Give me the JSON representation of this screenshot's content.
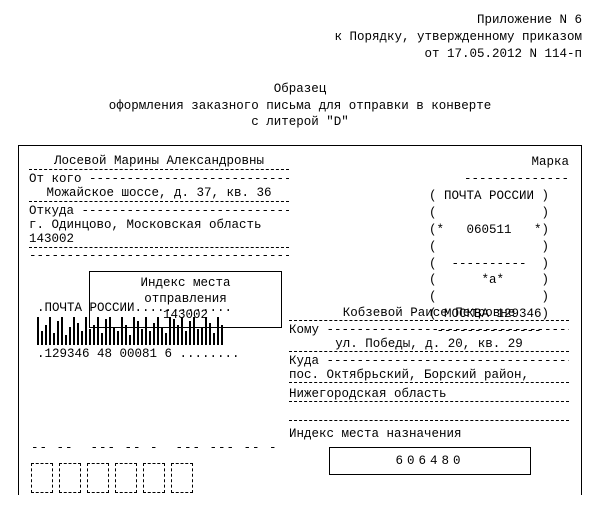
{
  "header": {
    "line1": "Приложение N 6",
    "line2": "к Порядку, утвержденному приказом",
    "line3": "от 17.05.2012 N 114-п"
  },
  "title": {
    "line1": "Образец",
    "line2": "оформления заказного письма для отправки в конверте",
    "line3": "с литерой \"D\""
  },
  "sender": {
    "from_label": "От кого",
    "from_value": "Лосевой Марины Александровны",
    "where_label": "Откуда",
    "addr1": "Можайское шоссе, д. 37, кв. 36",
    "addr2": "г. Одинцово, Московская область 143002",
    "index_label": "Индекс места отправления",
    "index_value": "143002"
  },
  "stamp": {
    "top_label": "Марка",
    "r1": "( ПОЧТА РОССИИ )",
    "r2": "(              )",
    "r3": "(*   060511   *)",
    "r4": "(              )",
    "r5": "(  ----------  )",
    "r6": "(      *a*     )",
    "r7": "(              )",
    "r8": "( МОСКВА 129346)"
  },
  "barcode": {
    "label": ".ПОЧТА РОССИИ.............",
    "digits": ".129346 48 00081 6 ........",
    "heights": [
      28,
      14,
      20,
      28,
      12,
      24,
      28,
      10,
      18,
      28,
      22,
      14,
      28,
      16,
      20,
      28,
      12,
      26,
      28,
      18,
      14,
      28,
      20,
      10,
      28,
      24,
      16,
      28,
      14,
      22,
      28,
      18,
      12,
      28,
      26,
      20,
      28,
      14,
      24,
      28,
      16,
      18,
      28,
      22,
      12,
      28,
      20
    ]
  },
  "recipient": {
    "to_label": "Кому",
    "to_value": "Кобзевой Раисе Петровне",
    "where_label": "Куда",
    "addr1": "ул. Победы, д. 20, кв. 29",
    "addr2": "пос. Октябрьский, Борский район,",
    "addr3": "Нижегородская область",
    "index_label": "Индекс места назначения",
    "index_value": "606480"
  },
  "bottom": {
    "dashes": "-- --  --- -- -  --- --- -- -"
  }
}
